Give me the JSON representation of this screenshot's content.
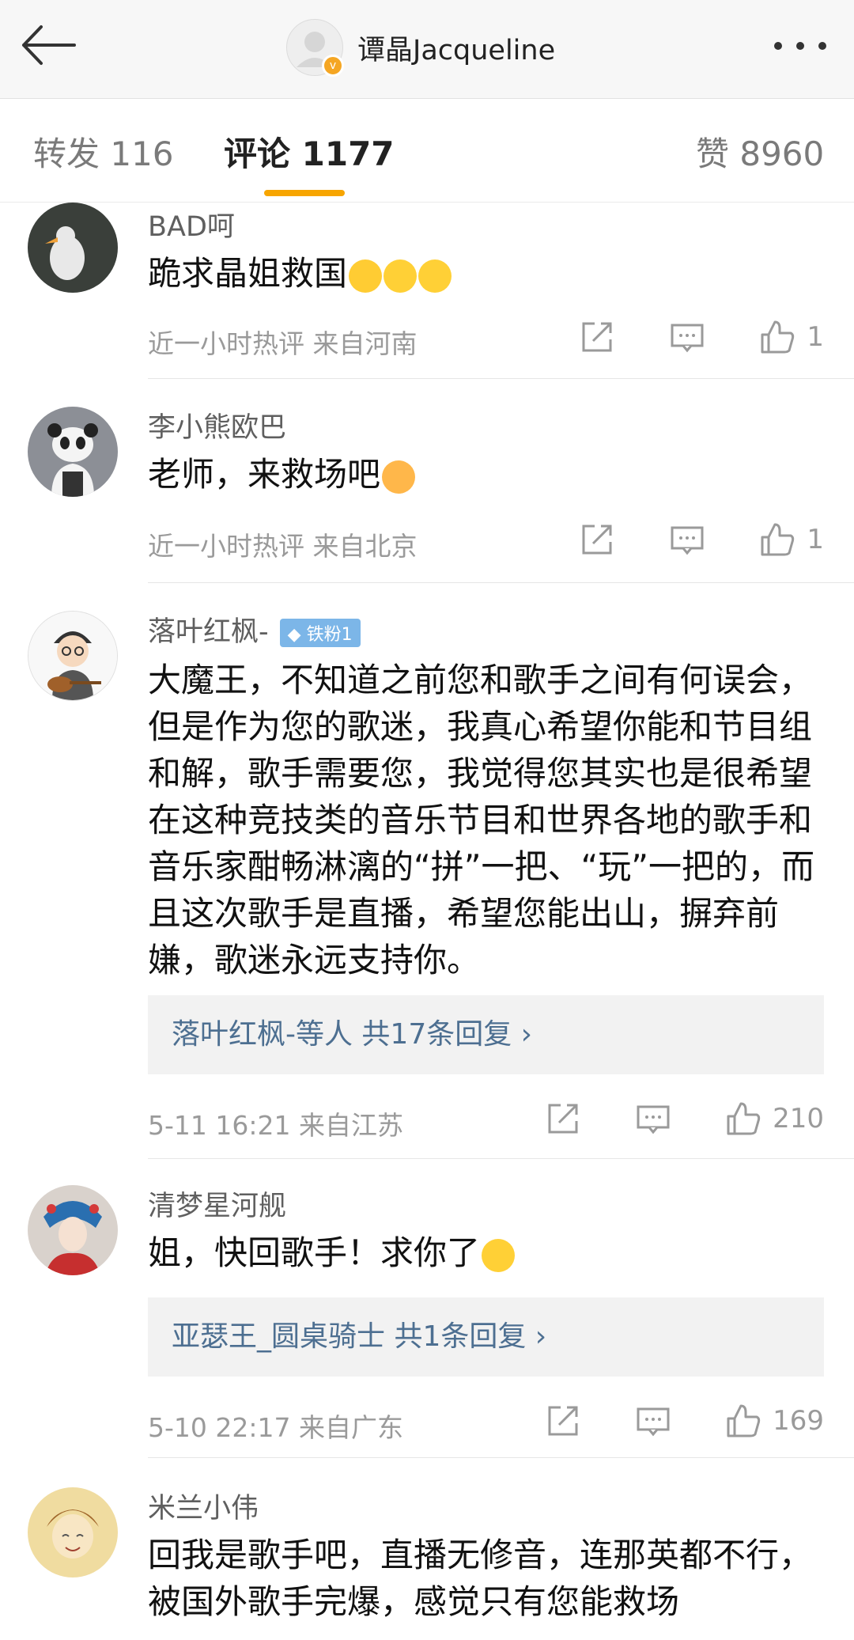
{
  "header": {
    "title": "谭晶Jacqueline",
    "verified_badge": "v"
  },
  "tabs": [
    {
      "label": "转发 116"
    },
    {
      "label": "评论 1177"
    },
    {
      "label": "赞 8960"
    }
  ],
  "comments": [
    {
      "user": "BAD呵",
      "text": "跪求晶姐救国",
      "emojis": [
        "crying-emoji",
        "crying-emoji",
        "crying-emoji"
      ],
      "meta": "近一小时热评  来自河南",
      "likes": "1"
    },
    {
      "user": "李小熊欧巴",
      "text": "老师，来救场吧",
      "emojis": [
        "tears-of-joy-emoji"
      ],
      "meta": "近一小时热评  来自北京",
      "likes": "1"
    },
    {
      "user": "落叶红枫-",
      "badge": "铁粉1",
      "text": "大魔王，不知道之前您和歌手之间有何误会，但是作为您的歌迷，我真心希望你能和节目组和解，歌手需要您，我觉得您其实也是很希望在这种竞技类的音乐节目和世界各地的歌手和音乐家酣畅淋漓的“拼”一把、“玩”一把的，而且这次歌手是直播，希望您能出山，摒弃前嫌，歌迷永远支持你。",
      "reply_summary": "落叶红枫-等人  共17条回复 ›",
      "meta": "5-11 16:21  来自江苏",
      "likes": "210"
    },
    {
      "user": "清梦星河舰",
      "text": "姐，快回歌手！求你了",
      "emojis": [
        "pleading-emoji"
      ],
      "reply_summary": "亚瑟王_圆桌骑士  共1条回复 ›",
      "meta": "5-10 22:17  来自广东",
      "likes": "169"
    },
    {
      "user": "米兰小伟",
      "text": "回我是歌手吧，直播无修音，连那英都不行，被国外歌手完爆，感觉只有您能救场"
    }
  ],
  "colors": {
    "accent": "#f7a500",
    "link": "#4d6f91",
    "meta": "#9a9a9a"
  }
}
